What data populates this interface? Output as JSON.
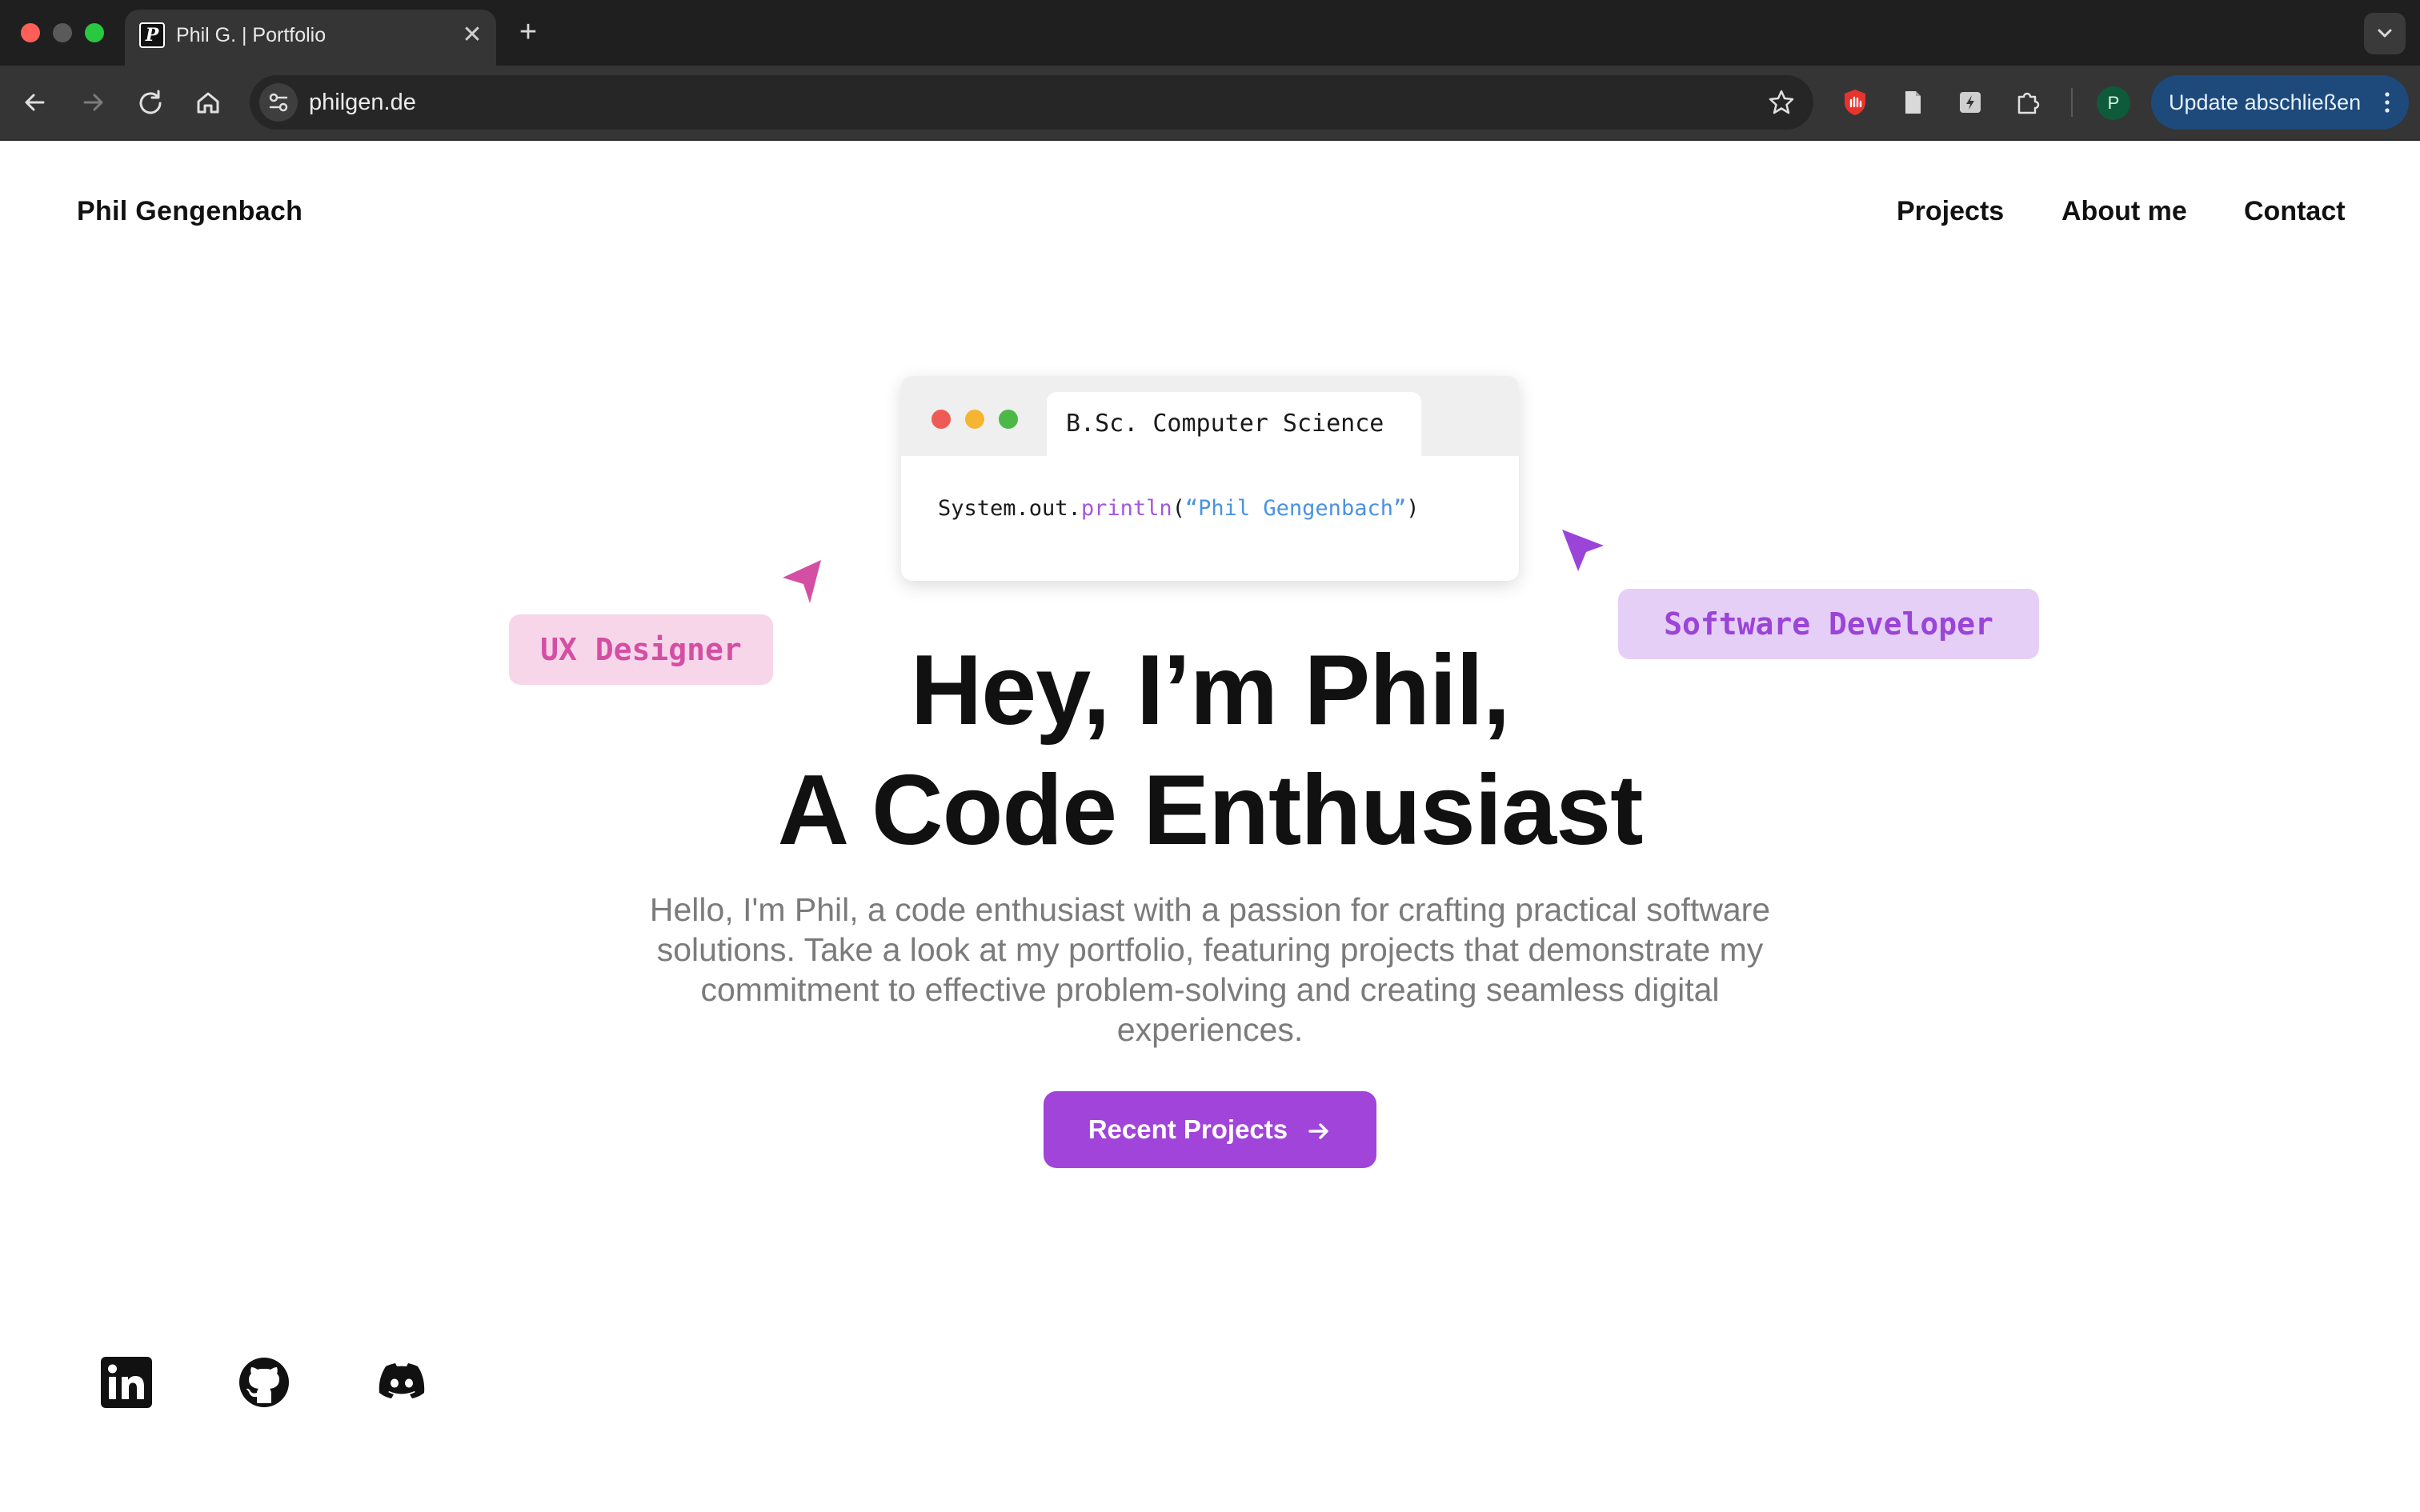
{
  "browser": {
    "tab_title": "Phil G. | Portfolio",
    "tab_favicon": "P",
    "tab_close": "✕",
    "new_tab": "+",
    "url": "philgen.de",
    "profile_initial": "P",
    "update_button_label": "Update abschließen"
  },
  "site": {
    "name": "Phil Gengenbach",
    "nav": [
      "Projects",
      "About me",
      "Contact"
    ]
  },
  "hero": {
    "card_tab_label": "B.Sc. Computer Science",
    "code": {
      "prefix": "System.out.",
      "method": "println",
      "open": "(",
      "string": "“Phil Gengenbach”",
      "close": ")"
    },
    "badges": {
      "ux": "UX Designer",
      "dev": "Software Developer"
    },
    "headline_line1": "Hey, I’m Phil,",
    "headline_line2": "A Code Enthusiast",
    "intro": "Hello, I'm Phil, a code enthusiast with a passion for crafting practical software solutions. Take a look at my portfolio, featuring projects that demonstrate my commitment to effective problem-solving and creating seamless digital experiences.",
    "cta_label": "Recent Projects"
  },
  "socials": [
    "linkedin-icon",
    "github-icon",
    "discord-icon"
  ],
  "colors": {
    "accent": "#a144da",
    "badge_ux_bg": "#f7d6ea",
    "badge_ux_text": "#d44fa4",
    "badge_dev_bg": "#e6cff7",
    "badge_dev_text": "#9a44d8",
    "code_method": "#a456dd",
    "code_string": "#4a92e0"
  }
}
